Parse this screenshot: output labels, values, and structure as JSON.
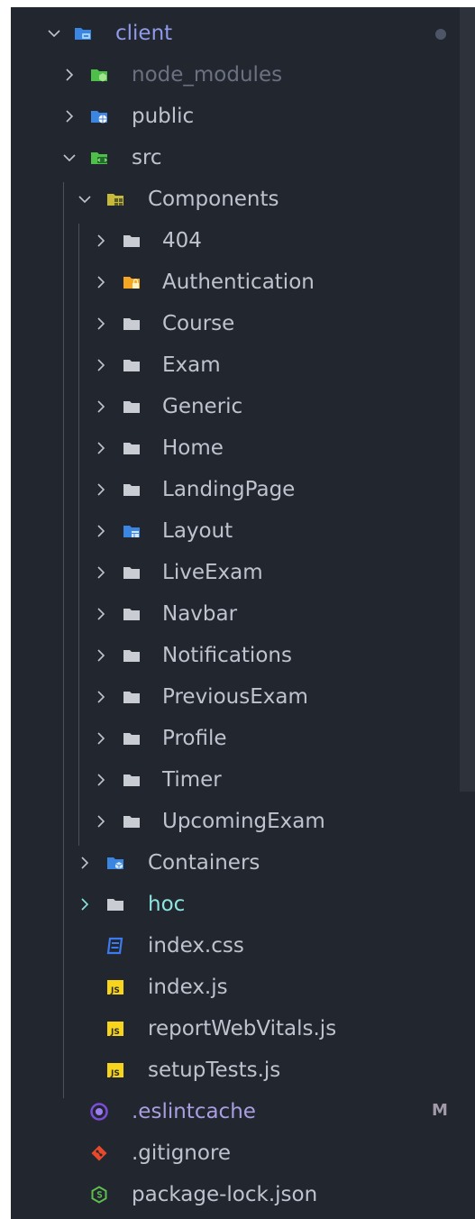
{
  "tree": {
    "client": {
      "label": "client"
    },
    "client_children": {
      "node_modules": {
        "label": "node_modules"
      },
      "public": {
        "label": "public"
      },
      "src": {
        "label": "src"
      }
    },
    "src_children": {
      "components": {
        "label": "Components"
      },
      "containers": {
        "label": "Containers"
      },
      "hoc": {
        "label": "hoc"
      },
      "index_css": {
        "label": "index.css"
      },
      "index_js": {
        "label": "index.js"
      },
      "report_web_vitals": {
        "label": "reportWebVitals.js"
      },
      "setup_tests": {
        "label": "setupTests.js"
      }
    },
    "component_folders": [
      {
        "label": "404"
      },
      {
        "label": "Authentication"
      },
      {
        "label": "Course"
      },
      {
        "label": "Exam"
      },
      {
        "label": "Generic"
      },
      {
        "label": "Home"
      },
      {
        "label": "LandingPage"
      },
      {
        "label": "Layout"
      },
      {
        "label": "LiveExam"
      },
      {
        "label": "Navbar"
      },
      {
        "label": "Notifications"
      },
      {
        "label": "PreviousExam"
      },
      {
        "label": "Profile"
      },
      {
        "label": "Timer"
      },
      {
        "label": "UpcomingExam"
      }
    ],
    "root_files": {
      "eslintcache": {
        "label": ".eslintcache",
        "git_status": "M"
      },
      "gitignore": {
        "label": ".gitignore"
      },
      "package_lock": {
        "label": "package-lock.json"
      }
    }
  },
  "colors": {
    "background": "#22262f",
    "text": "#bec3ce",
    "muted_text": "#6b7180",
    "hoc_text": "#8ee5e0",
    "client_text": "#8f9ae8",
    "folder_gray": "#c9ccd3",
    "folder_blue": "#3b86e0",
    "folder_green": "#4ec04a",
    "folder_orange": "#f5a623",
    "js_yellow": "#f7d51d",
    "css_blue": "#3b7bef",
    "git_red": "#e8492b",
    "eslint_purple": "#7b4dd8",
    "modified_badge": "#a39aa9"
  }
}
